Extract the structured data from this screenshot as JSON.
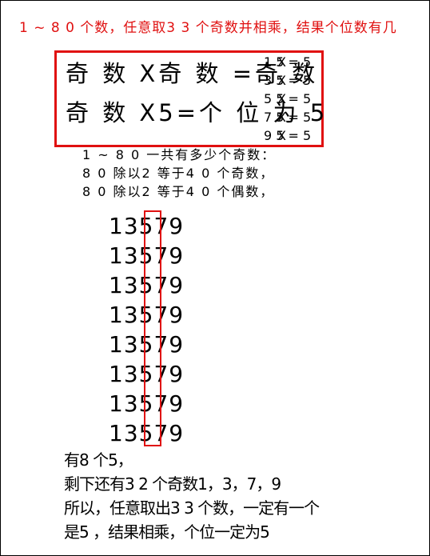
{
  "title": "1 ~ 8 0 个数，任意取3 3 个奇数并相乘，结果个位数有几",
  "formula_line_1": "奇 数 X奇 数 =奇 数",
  "formula_line_2": "奇 数 X5=个 位 为 5",
  "products": [
    "1 5 = 5",
    "3 5 = 5",
    "5 5 = 5",
    "7 5 = 5",
    "9 5 = 5"
  ],
  "products_overlay": [
    "X",
    "X",
    "X",
    "X",
    "X"
  ],
  "count_lines": [
    "1 ~ 8 0 一共有多少个奇数：",
    "8 0 除以2 等于4 0 个奇数，",
    "8 0 除以2 等于4 0 个偶数，"
  ],
  "digit_rows": [
    "13579",
    "13579",
    "13579",
    "13579",
    "13579",
    "13579",
    "13579",
    "13579"
  ],
  "conclusion_lines": [
    "有8 个5，",
    "剩下还有3 2 个奇数1，3，7，9",
    "所以，任意取出3 3 个数，一定有一个",
    "是5 ，结果相乘，个位一定为5"
  ]
}
